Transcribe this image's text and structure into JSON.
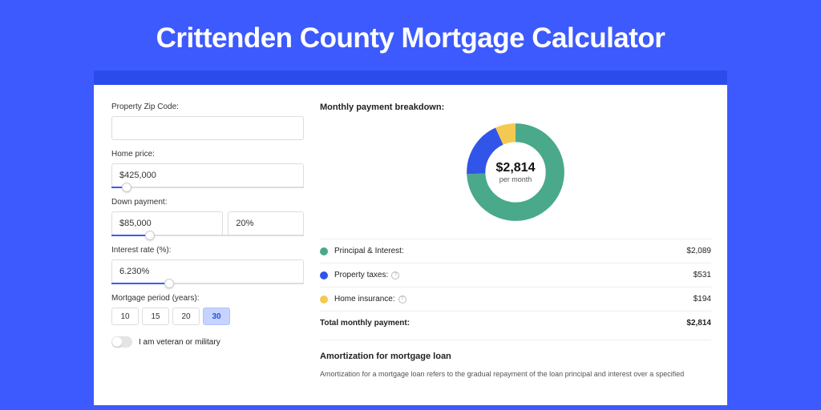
{
  "title": "Crittenden County Mortgage Calculator",
  "form": {
    "zip_label": "Property Zip Code:",
    "zip_value": "",
    "price_label": "Home price:",
    "price_value": "$425,000",
    "price_slider_pct": 8,
    "down_label": "Down payment:",
    "down_value": "$85,000",
    "down_pct_value": "20%",
    "down_slider_pct": 20,
    "rate_label": "Interest rate (%):",
    "rate_value": "6.230%",
    "rate_slider_pct": 30,
    "period_label": "Mortgage period (years):",
    "periods": [
      "10",
      "15",
      "20",
      "30"
    ],
    "period_active_index": 3,
    "veteran_label": "I am veteran or military"
  },
  "breakdown": {
    "title": "Monthly payment breakdown:",
    "center_amount": "$2,814",
    "center_sub": "per month",
    "rows": [
      {
        "label": "Principal & Interest:",
        "value": "$2,089",
        "color": "#49a98a",
        "info": false
      },
      {
        "label": "Property taxes:",
        "value": "$531",
        "color": "#3155e8",
        "info": true
      },
      {
        "label": "Home insurance:",
        "value": "$194",
        "color": "#f4c951",
        "info": true
      }
    ],
    "total_label": "Total monthly payment:",
    "total_value": "$2,814"
  },
  "chart_data": {
    "type": "pie",
    "title": "Monthly payment breakdown",
    "series": [
      {
        "name": "Principal & Interest",
        "value": 2089,
        "color": "#49a98a"
      },
      {
        "name": "Property taxes",
        "value": 531,
        "color": "#3155e8"
      },
      {
        "name": "Home insurance",
        "value": 194,
        "color": "#f4c951"
      }
    ],
    "total": 2814,
    "unit": "USD per month"
  },
  "amortization": {
    "title": "Amortization for mortgage loan",
    "text": "Amortization for a mortgage loan refers to the gradual repayment of the loan principal and interest over a specified"
  }
}
